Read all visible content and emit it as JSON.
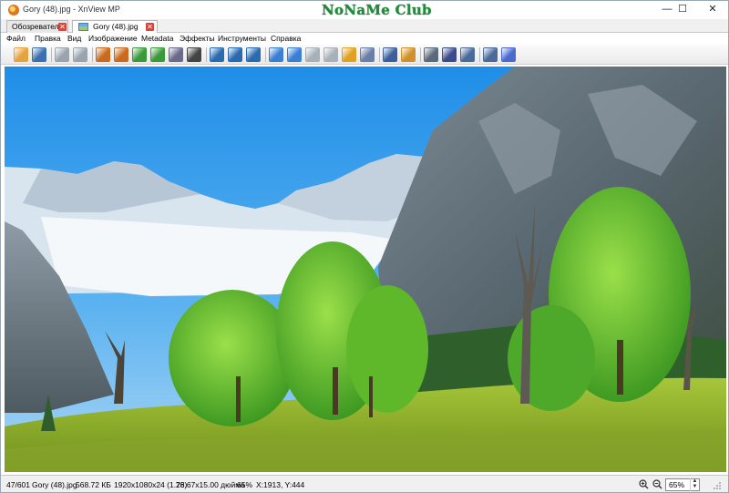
{
  "window": {
    "title": "Gory (48).jpg - XnView MP",
    "brand": "NoNaMe Club",
    "controls": {
      "minimize": "—",
      "maximize": "☐",
      "close": "✕"
    }
  },
  "tabs": [
    {
      "label": "Обозреватель",
      "close": "✕"
    },
    {
      "label": "Gory (48).jpg",
      "close": "✕"
    }
  ],
  "menu": [
    "Файл",
    "Правка",
    "Вид",
    "Изображение",
    "Metadata",
    "Эффекты",
    "Инструменты",
    "Справка"
  ],
  "toolbar": {
    "buttons": [
      {
        "name": "browse-icon",
        "color": "#e6a23c"
      },
      {
        "name": "save-icon",
        "color": "#3b6fb0"
      },
      {
        "name": "print-preview-icon",
        "color": "#9aa4ae"
      },
      {
        "name": "scan-icon",
        "color": "#9aa4ae"
      },
      {
        "name": "crop-icon",
        "color": "#c96a1e"
      },
      {
        "name": "resize-icon",
        "color": "#c96a1e"
      },
      {
        "name": "rotate-left-icon",
        "color": "#3a9a3a"
      },
      {
        "name": "rotate-right-icon",
        "color": "#3a9a3a"
      },
      {
        "name": "adjust-icon",
        "color": "#6a6a8a"
      },
      {
        "name": "histogram-icon",
        "color": "#444444"
      },
      {
        "name": "zoom-in-icon",
        "color": "#2a6bb0"
      },
      {
        "name": "zoom-fit-icon",
        "color": "#2a6bb0"
      },
      {
        "name": "zoom-out-icon",
        "color": "#2a6bb0"
      },
      {
        "name": "previous-icon",
        "color": "#3a7fd4"
      },
      {
        "name": "next-icon",
        "color": "#3a7fd4"
      },
      {
        "name": "first-icon",
        "color": "#a8b0b8"
      },
      {
        "name": "last-icon",
        "color": "#a8b0b8"
      },
      {
        "name": "slideshow-icon",
        "color": "#e0a020"
      },
      {
        "name": "compare-icon",
        "color": "#6a7fa8"
      },
      {
        "name": "fullscreen-icon",
        "color": "#3a5f9a"
      },
      {
        "name": "edit-icon",
        "color": "#d0902a"
      },
      {
        "name": "print-icon",
        "color": "#5a6a7a"
      },
      {
        "name": "scanner-icon",
        "color": "#3a4a8a"
      },
      {
        "name": "screenshot-icon",
        "color": "#4a6a9a"
      },
      {
        "name": "settings-icon",
        "color": "#4a6a9a"
      },
      {
        "name": "help-icon",
        "color": "#4a6ad0"
      }
    ]
  },
  "status": {
    "index": "47/601",
    "filename": "Gory (48).jpg",
    "filesize": "568.72 КБ",
    "dimensions": "1920x1080x24 (1.78)",
    "print_size": "26.67x15.00 дюйма",
    "zoom_percent": "65%",
    "coords": "X:1913, Y:444",
    "zoom_value": "65%",
    "spin_up": "▲",
    "spin_down": "▼"
  }
}
